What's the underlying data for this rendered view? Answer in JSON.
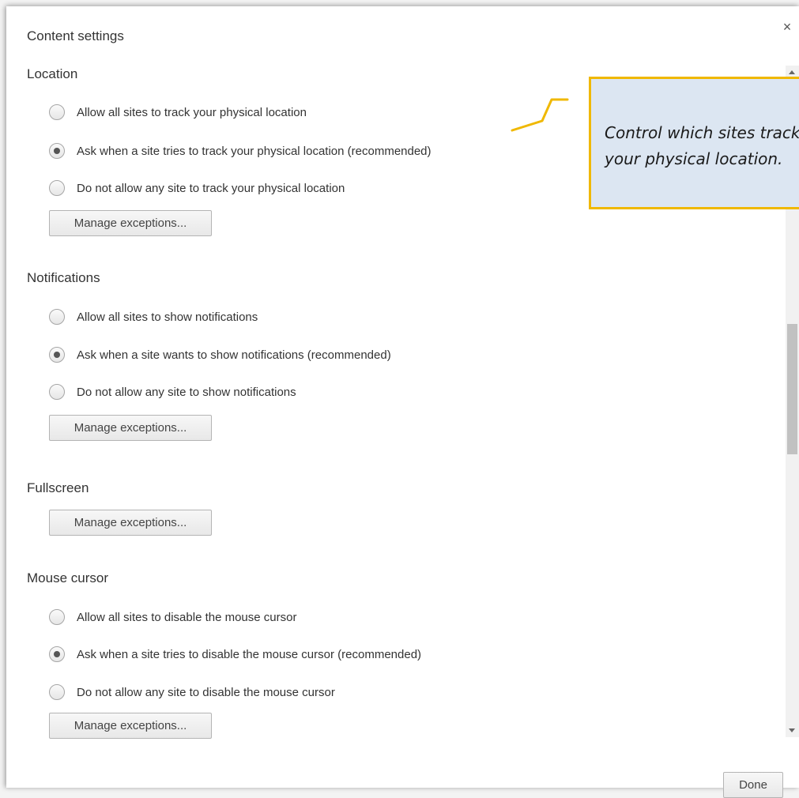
{
  "dialog": {
    "title": "Content settings",
    "close_label": "×",
    "done_label": "Done"
  },
  "sections": {
    "location": {
      "heading": "Location",
      "options": [
        "Allow all sites to track your physical location",
        "Ask when a site tries to track your physical location (recommended)",
        "Do not allow any site to track your physical location"
      ],
      "selected_index": 1,
      "manage_label": "Manage exceptions..."
    },
    "notifications": {
      "heading": "Notifications",
      "options": [
        "Allow all sites to show notifications",
        "Ask when a site wants to show notifications (recommended)",
        "Do not allow any site to show notifications"
      ],
      "selected_index": 1,
      "manage_label": "Manage exceptions..."
    },
    "fullscreen": {
      "heading": "Fullscreen",
      "manage_label": "Manage exceptions..."
    },
    "mouse_cursor": {
      "heading": "Mouse cursor",
      "options": [
        "Allow all sites to disable the mouse cursor",
        "Ask when a site tries to disable the mouse cursor (recommended)",
        "Do not allow any site to disable the mouse cursor"
      ],
      "selected_index": 1,
      "manage_label": "Manage exceptions..."
    }
  },
  "callout": {
    "text": "Control which sites track your physical location."
  },
  "colors": {
    "callout_fill": "#dce6f2",
    "callout_border": "#f0b800",
    "text": "#333333"
  }
}
